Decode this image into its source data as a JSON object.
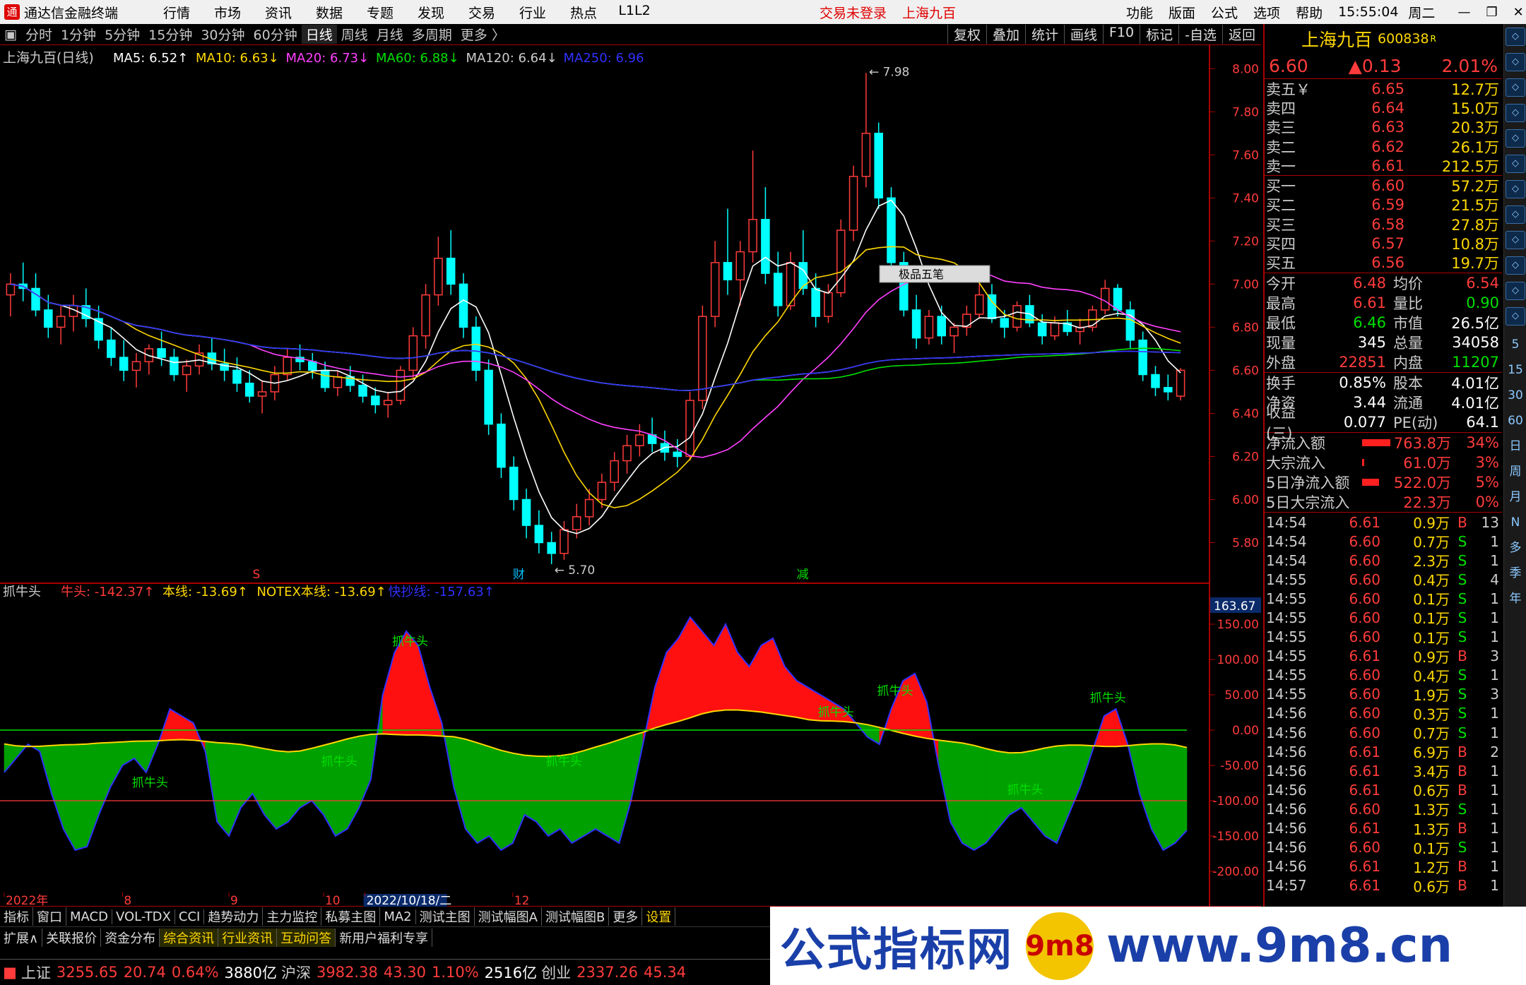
{
  "window": {
    "app_name": "通达信金融终端",
    "menu": [
      "行情",
      "市场",
      "资讯",
      "数据",
      "专题",
      "发现",
      "交易",
      "行业",
      "热点",
      "L1L2"
    ],
    "trade_status": "交易未登录",
    "stock_title": "上海九百",
    "right_menu": [
      "功能",
      "版面",
      "公式",
      "选项",
      "帮助"
    ],
    "time": "15:55:04",
    "weekday": "周二"
  },
  "period_bar": {
    "items": [
      "分时",
      "1分钟",
      "5分钟",
      "15分钟",
      "30分钟",
      "60分钟",
      "日线",
      "周线",
      "月线",
      "多周期",
      "更多 〉"
    ],
    "active": "日线",
    "tools": [
      "复权",
      "叠加",
      "统计",
      "画线",
      "F10",
      "标记",
      "-自选",
      "返回"
    ]
  },
  "main_chart": {
    "header_name": "上海九百(日线)",
    "ma_labels": [
      {
        "text": "MA5: 6.52↑",
        "color": "#ffffff"
      },
      {
        "text": "MA10: 6.63↓",
        "color": "#ffd800"
      },
      {
        "text": "MA20: 6.73↓",
        "color": "#ff40ff"
      },
      {
        "text": "MA60: 6.88↓",
        "color": "#00e000"
      },
      {
        "text": "MA120: 6.64↓",
        "color": "#cccccc"
      },
      {
        "text": "MA250: 6.96",
        "color": "#3030ff"
      }
    ],
    "y_ticks": [
      "8.00",
      "7.80",
      "7.60",
      "7.40",
      "7.20",
      "7.00",
      "6.80",
      "6.60",
      "6.40",
      "6.20",
      "6.00",
      "5.80"
    ],
    "y_range": [
      5.7,
      8.05
    ],
    "high_marker": "7.98",
    "low_marker": "5.70",
    "popup_label": "极品五笔",
    "markers": [
      {
        "text": "S",
        "color": "#ff3b3b"
      },
      {
        "text": "财",
        "color": "#00c0ff"
      },
      {
        "text": "减",
        "color": "#00e000"
      }
    ]
  },
  "indicator": {
    "name": "抓牛头",
    "labels": [
      {
        "text": "牛头: -142.37↑",
        "color": "#ff3b3b"
      },
      {
        "text": "本线: -13.69↑",
        "color": "#ffd800"
      },
      {
        "text": "NOTEX本线: -13.69↑",
        "color": "#ffd800"
      },
      {
        "text": "快抄线: -157.63↑",
        "color": "#3030ff"
      }
    ],
    "current_value": "163.67",
    "y_ticks": [
      "150.00",
      "100.00",
      "50.00",
      "0.00",
      "-50.00",
      "-100.00",
      "-150.00",
      "-200.00"
    ],
    "signal_label": "抓牛头"
  },
  "x_axis": {
    "labels": [
      "2022年",
      "8",
      "9",
      "10",
      "2022/10/18/二",
      "12"
    ]
  },
  "quote": {
    "name": "上海九百",
    "code": "600838",
    "r_mark": "R",
    "price": "6.60",
    "change": "▲0.13",
    "pct": "2.01%",
    "asks": [
      {
        "label": "卖五￥",
        "price": "6.65",
        "vol": "12.7万"
      },
      {
        "label": "卖四",
        "price": "6.64",
        "vol": "15.0万"
      },
      {
        "label": "卖三",
        "price": "6.63",
        "vol": "20.3万"
      },
      {
        "label": "卖二",
        "price": "6.62",
        "vol": "26.1万"
      },
      {
        "label": "卖一",
        "price": "6.61",
        "vol": "212.5万"
      }
    ],
    "bids": [
      {
        "label": "买一",
        "price": "6.60",
        "vol": "57.2万"
      },
      {
        "label": "买二",
        "price": "6.59",
        "vol": "21.5万"
      },
      {
        "label": "买三",
        "price": "6.58",
        "vol": "27.8万"
      },
      {
        "label": "买四",
        "price": "6.57",
        "vol": "10.8万"
      },
      {
        "label": "买五",
        "price": "6.56",
        "vol": "19.7万"
      }
    ],
    "stats1": [
      {
        "k": "今开",
        "v": "6.48",
        "vc": "red",
        "k2": "均价",
        "v2": "6.54",
        "v2c": "red"
      },
      {
        "k": "最高",
        "v": "6.61",
        "vc": "red",
        "k2": "量比",
        "v2": "0.90",
        "v2c": "green"
      },
      {
        "k": "最低",
        "v": "6.46",
        "vc": "green",
        "k2": "市值",
        "v2": "26.5亿",
        "v2c": "wht"
      },
      {
        "k": "现量",
        "v": "345",
        "vc": "wht",
        "k2": "总量",
        "v2": "34058",
        "v2c": "wht"
      },
      {
        "k": "外盘",
        "v": "22851",
        "vc": "red",
        "k2": "内盘",
        "v2": "11207",
        "v2c": "green"
      }
    ],
    "stats2": [
      {
        "k": "换手",
        "v": "0.85%",
        "vc": "wht",
        "k2": "股本",
        "v2": "4.01亿",
        "v2c": "wht"
      },
      {
        "k": "净资",
        "v": "3.44",
        "vc": "wht",
        "k2": "流通",
        "v2": "4.01亿",
        "v2c": "wht"
      },
      {
        "k": "收益(三)",
        "v": "0.077",
        "vc": "wht",
        "k2": "PE(动)",
        "v2": "64.1",
        "v2c": "wht"
      }
    ],
    "flows": [
      {
        "k": "净流入额",
        "v": "763.8万",
        "p": "34%",
        "bar": 40
      },
      {
        "k": "大宗流入",
        "v": "61.0万",
        "p": "3%",
        "bar": 3
      },
      {
        "k": "5日净流入额",
        "v": "522.0万",
        "p": "5%",
        "bar": 24
      },
      {
        "k": "5日大宗流入",
        "v": "22.3万",
        "p": "0%",
        "bar": 0
      }
    ],
    "ticks": [
      [
        "14:54",
        "6.61",
        "0.9万",
        "B",
        "13"
      ],
      [
        "14:54",
        "6.60",
        "0.7万",
        "S",
        "1"
      ],
      [
        "14:54",
        "6.60",
        "2.3万",
        "S",
        "1"
      ],
      [
        "14:55",
        "6.60",
        "0.4万",
        "S",
        "4"
      ],
      [
        "14:55",
        "6.60",
        "0.1万",
        "S",
        "1"
      ],
      [
        "14:55",
        "6.60",
        "0.1万",
        "S",
        "1"
      ],
      [
        "14:55",
        "6.60",
        "0.1万",
        "S",
        "1"
      ],
      [
        "14:55",
        "6.61",
        "0.9万",
        "B",
        "3"
      ],
      [
        "14:55",
        "6.60",
        "0.4万",
        "S",
        "1"
      ],
      [
        "14:55",
        "6.60",
        "1.9万",
        "S",
        "3"
      ],
      [
        "14:56",
        "6.60",
        "0.3万",
        "S",
        "1"
      ],
      [
        "14:56",
        "6.60",
        "0.7万",
        "S",
        "1"
      ],
      [
        "14:56",
        "6.61",
        "6.9万",
        "B",
        "2"
      ],
      [
        "14:56",
        "6.61",
        "3.4万",
        "B",
        "1"
      ],
      [
        "14:56",
        "6.61",
        "0.6万",
        "B",
        "1"
      ],
      [
        "14:56",
        "6.60",
        "1.3万",
        "S",
        "1"
      ],
      [
        "14:56",
        "6.61",
        "1.3万",
        "B",
        "1"
      ],
      [
        "14:56",
        "6.60",
        "0.1万",
        "S",
        "1"
      ],
      [
        "14:56",
        "6.61",
        "1.2万",
        "B",
        "1"
      ],
      [
        "14:57",
        "6.61",
        "0.6万",
        "B",
        "1"
      ]
    ]
  },
  "sidebar": {
    "text_buttons": [
      "日",
      "周",
      "月",
      "N",
      "多",
      "季",
      "年"
    ],
    "min_buttons": [
      "5",
      "15",
      "30",
      "60"
    ],
    "icons": [
      "up-icon",
      "down-icon",
      "chart-icon",
      "candle-icon",
      "list-icon",
      "info-icon",
      "grid-icon",
      "arrow-icon",
      "rsi-icon",
      "target-icon",
      "pen-icon",
      "fs-icon"
    ]
  },
  "bottom_tabs": {
    "row1": [
      "指标",
      "窗口",
      "MACD",
      "VOL-TDX",
      "CCI",
      "趋势动力",
      "主力监控",
      "私募主图",
      "MA2",
      "测试主图",
      "测试幅图A",
      "测试幅图B",
      "更多",
      "设置"
    ],
    "row2": [
      "扩展∧",
      "关联报价",
      "资金分布",
      "综合资讯",
      "行业资讯",
      "互动问答",
      "新用户福利专享"
    ]
  },
  "status": {
    "items": [
      {
        "name": "上证",
        "value": "3255.65",
        "chg": "20.74",
        "pct": "0.64%",
        "amt": "3880亿"
      },
      {
        "name": "沪深",
        "value": "3982.38",
        "chg": "43.30",
        "pct": "1.10%",
        "amt": "2516亿"
      },
      {
        "name": "创业",
        "value": "2337.26",
        "chg": "45.34",
        "pct": "",
        "amt": ""
      }
    ]
  },
  "watermark": {
    "left": "公式指标网",
    "right": "www.9m8.cn",
    "badge": "9m8"
  },
  "chart_data": {
    "type": "candlestick",
    "title": "上海九百(日线)",
    "ylim": [
      5.7,
      8.05
    ],
    "candles": [
      [
        6.95,
        7.05,
        6.85,
        7.0
      ],
      [
        7.0,
        7.1,
        6.92,
        6.98
      ],
      [
        6.98,
        7.05,
        6.85,
        6.88
      ],
      [
        6.88,
        6.95,
        6.75,
        6.8
      ],
      [
        6.8,
        6.9,
        6.72,
        6.85
      ],
      [
        6.85,
        6.95,
        6.78,
        6.9
      ],
      [
        6.9,
        6.98,
        6.8,
        6.84
      ],
      [
        6.84,
        6.9,
        6.7,
        6.74
      ],
      [
        6.74,
        6.8,
        6.62,
        6.66
      ],
      [
        6.66,
        6.74,
        6.55,
        6.6
      ],
      [
        6.6,
        6.68,
        6.52,
        6.64
      ],
      [
        6.64,
        6.72,
        6.58,
        6.7
      ],
      [
        6.7,
        6.78,
        6.62,
        6.66
      ],
      [
        6.66,
        6.7,
        6.55,
        6.58
      ],
      [
        6.58,
        6.65,
        6.5,
        6.62
      ],
      [
        6.62,
        6.72,
        6.58,
        6.68
      ],
      [
        6.68,
        6.75,
        6.6,
        6.63
      ],
      [
        6.63,
        6.7,
        6.55,
        6.6
      ],
      [
        6.6,
        6.66,
        6.5,
        6.54
      ],
      [
        6.54,
        6.6,
        6.45,
        6.48
      ],
      [
        6.48,
        6.55,
        6.4,
        6.5
      ],
      [
        6.5,
        6.62,
        6.46,
        6.58
      ],
      [
        6.58,
        6.7,
        6.55,
        6.66
      ],
      [
        6.66,
        6.72,
        6.6,
        6.64
      ],
      [
        6.64,
        6.68,
        6.56,
        6.6
      ],
      [
        6.6,
        6.64,
        6.5,
        6.52
      ],
      [
        6.52,
        6.6,
        6.48,
        6.57
      ],
      [
        6.57,
        6.62,
        6.5,
        6.53
      ],
      [
        6.53,
        6.58,
        6.45,
        6.48
      ],
      [
        6.48,
        6.52,
        6.4,
        6.44
      ],
      [
        6.44,
        6.5,
        6.38,
        6.46
      ],
      [
        6.46,
        6.62,
        6.44,
        6.6
      ],
      [
        6.6,
        6.8,
        6.56,
        6.76
      ],
      [
        6.76,
        7.0,
        6.7,
        6.95
      ],
      [
        6.95,
        7.22,
        6.9,
        7.12
      ],
      [
        7.12,
        7.25,
        6.95,
        7.0
      ],
      [
        7.0,
        7.05,
        6.75,
        6.8
      ],
      [
        6.8,
        6.85,
        6.55,
        6.6
      ],
      [
        6.6,
        6.65,
        6.3,
        6.35
      ],
      [
        6.35,
        6.4,
        6.1,
        6.15
      ],
      [
        6.15,
        6.2,
        5.95,
        6.0
      ],
      [
        6.0,
        6.05,
        5.82,
        5.88
      ],
      [
        5.88,
        5.95,
        5.75,
        5.8
      ],
      [
        5.8,
        5.85,
        5.7,
        5.75
      ],
      [
        5.75,
        5.9,
        5.72,
        5.86
      ],
      [
        5.86,
        5.98,
        5.82,
        5.92
      ],
      [
        5.92,
        6.05,
        5.88,
        6.0
      ],
      [
        6.0,
        6.12,
        5.96,
        6.08
      ],
      [
        6.08,
        6.22,
        6.04,
        6.18
      ],
      [
        6.18,
        6.3,
        6.12,
        6.25
      ],
      [
        6.25,
        6.35,
        6.2,
        6.3
      ],
      [
        6.3,
        6.38,
        6.22,
        6.26
      ],
      [
        6.26,
        6.32,
        6.18,
        6.22
      ],
      [
        6.22,
        6.28,
        6.15,
        6.2
      ],
      [
        6.2,
        6.5,
        6.18,
        6.46
      ],
      [
        6.46,
        6.9,
        6.42,
        6.85
      ],
      [
        6.85,
        7.2,
        6.8,
        7.1
      ],
      [
        7.1,
        7.35,
        6.95,
        7.02
      ],
      [
        7.02,
        7.2,
        6.9,
        7.15
      ],
      [
        7.15,
        7.62,
        7.1,
        7.3
      ],
      [
        7.3,
        7.45,
        7.0,
        7.05
      ],
      [
        7.05,
        7.15,
        6.85,
        6.9
      ],
      [
        6.9,
        7.15,
        6.88,
        7.1
      ],
      [
        7.1,
        7.25,
        6.95,
        6.98
      ],
      [
        6.98,
        7.05,
        6.8,
        6.85
      ],
      [
        6.85,
        7.0,
        6.82,
        6.96
      ],
      [
        6.96,
        7.3,
        6.94,
        7.25
      ],
      [
        7.25,
        7.55,
        7.2,
        7.5
      ],
      [
        7.5,
        7.98,
        7.45,
        7.7
      ],
      [
        7.7,
        7.75,
        7.35,
        7.4
      ],
      [
        7.4,
        7.45,
        7.05,
        7.1
      ],
      [
        7.1,
        7.15,
        6.85,
        6.88
      ],
      [
        6.88,
        6.95,
        6.7,
        6.75
      ],
      [
        6.75,
        6.88,
        6.72,
        6.85
      ],
      [
        6.85,
        6.9,
        6.72,
        6.76
      ],
      [
        6.76,
        6.82,
        6.68,
        6.8
      ],
      [
        6.8,
        6.9,
        6.76,
        6.86
      ],
      [
        6.86,
        7.0,
        6.84,
        6.95
      ],
      [
        6.95,
        7.0,
        6.82,
        6.84
      ],
      [
        6.84,
        6.88,
        6.75,
        6.8
      ],
      [
        6.8,
        6.92,
        6.78,
        6.9
      ],
      [
        6.9,
        6.95,
        6.8,
        6.82
      ],
      [
        6.82,
        6.86,
        6.72,
        6.76
      ],
      [
        6.76,
        6.85,
        6.74,
        6.82
      ],
      [
        6.82,
        6.88,
        6.76,
        6.78
      ],
      [
        6.78,
        6.84,
        6.72,
        6.8
      ],
      [
        6.8,
        6.9,
        6.78,
        6.88
      ],
      [
        6.88,
        7.02,
        6.86,
        6.98
      ],
      [
        6.98,
        7.0,
        6.85,
        6.88
      ],
      [
        6.88,
        6.92,
        6.7,
        6.74
      ],
      [
        6.74,
        6.78,
        6.55,
        6.58
      ],
      [
        6.58,
        6.62,
        6.48,
        6.52
      ],
      [
        6.52,
        6.58,
        6.46,
        6.5
      ],
      [
        6.48,
        6.61,
        6.46,
        6.6
      ]
    ],
    "ma_series": [
      {
        "name": "MA5",
        "color": "#ffffff"
      },
      {
        "name": "MA10",
        "color": "#ffd800"
      },
      {
        "name": "MA20",
        "color": "#ff40ff"
      },
      {
        "name": "MA60",
        "color": "#00e000"
      },
      {
        "name": "MA120",
        "color": "#cccccc"
      },
      {
        "name": "MA250",
        "color": "#3030ff"
      }
    ],
    "indicator_ylim": [
      -230,
      180
    ],
    "indicator_series": {
      "牛头": [
        -60,
        -40,
        -20,
        -30,
        -90,
        -140,
        -170,
        -165,
        -120,
        -80,
        -50,
        -40,
        -60,
        -20,
        30,
        20,
        10,
        -30,
        -130,
        -150,
        -110,
        -90,
        -120,
        -140,
        -130,
        -110,
        -100,
        -120,
        -150,
        -140,
        -110,
        -70,
        50,
        110,
        140,
        120,
        60,
        10,
        -80,
        -140,
        -160,
        -150,
        -170,
        -160,
        -120,
        -130,
        -150,
        -140,
        -160,
        -150,
        -140,
        -150,
        -160,
        -100,
        -20,
        60,
        110,
        130,
        160,
        140,
        120,
        150,
        110,
        90,
        120,
        130,
        90,
        70,
        60,
        50,
        40,
        30,
        10,
        -10,
        -20,
        30,
        70,
        80,
        40,
        -50,
        -130,
        -160,
        -170,
        -160,
        -140,
        -120,
        -110,
        -130,
        -150,
        -160,
        -120,
        -80,
        -30,
        20,
        30,
        -20,
        -90,
        -140,
        -170,
        -160,
        -142
      ]
    }
  }
}
